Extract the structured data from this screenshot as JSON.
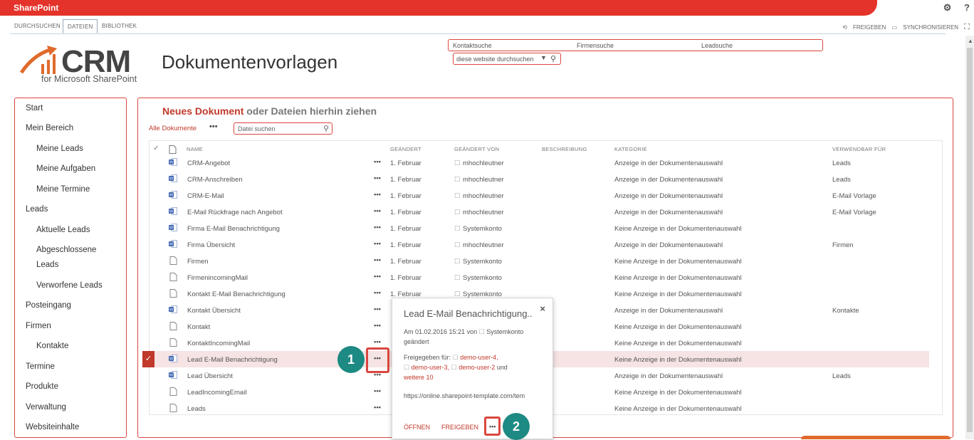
{
  "app": {
    "title": "SharePoint"
  },
  "topicons": {
    "settings": "⚙",
    "help": "?"
  },
  "ribbon": {
    "tabs": [
      "DURCHSUCHEN",
      "DATEIEN",
      "BIBLIOTHEK"
    ]
  },
  "actions": {
    "share": "FREIGEBEN",
    "sync": "SYNCHRONISIEREN"
  },
  "logo": {
    "name": "CRM",
    "sub": "for Microsoft SharePoint"
  },
  "page": {
    "title": "Dokumentenvorlagen"
  },
  "search": {
    "contact": "Kontaktsuche",
    "company": "Firmensuche",
    "lead": "Leadsuche",
    "site_placeholder": "diese website durchsuchen"
  },
  "nav": [
    {
      "label": "Start",
      "level": 0
    },
    {
      "label": "Mein Bereich",
      "level": 0
    },
    {
      "label": "Meine Leads",
      "level": 1
    },
    {
      "label": "Meine Aufgaben",
      "level": 1
    },
    {
      "label": "Meine Termine",
      "level": 1
    },
    {
      "label": "Leads",
      "level": 0
    },
    {
      "label": "Aktuelle Leads",
      "level": 1
    },
    {
      "label": "Abgeschlossene Leads",
      "level": 1
    },
    {
      "label": "Verworfene Leads",
      "level": 1
    },
    {
      "label": "Posteingang",
      "level": 0
    },
    {
      "label": "Firmen",
      "level": 0
    },
    {
      "label": "Kontakte",
      "level": 1
    },
    {
      "label": "Termine",
      "level": 0
    },
    {
      "label": "Produkte",
      "level": 0
    },
    {
      "label": "Verwaltung",
      "level": 0
    },
    {
      "label": "Websiteinhalte",
      "level": 0
    }
  ],
  "library": {
    "new_doc": "Neues Dokument",
    "drag_text": "oder Dateien hierhin ziehen",
    "view": "Alle Dokumente",
    "more": "•••",
    "file_search_placeholder": "Datei suchen",
    "columns": {
      "check": "✓",
      "name": "NAME",
      "modified": "GEÄNDERT",
      "modified_by": "GEÄNDERT VON",
      "description": "BESCHREIBUNG",
      "category": "KATEGORIE",
      "usable_for": "VERWENDBAR FÜR"
    },
    "rows": [
      {
        "icon": "word",
        "name": "CRM-Angebot",
        "modified": "1. Februar",
        "by": "mhochleutner",
        "category": "Anzeige in der Dokumentenauswahl",
        "usable": "Leads"
      },
      {
        "icon": "word",
        "name": "CRM-Anschreiben",
        "modified": "1. Februar",
        "by": "mhochleutner",
        "category": "Anzeige in der Dokumentenauswahl",
        "usable": "Leads"
      },
      {
        "icon": "word",
        "name": "CRM-E-Mail",
        "modified": "1. Februar",
        "by": "mhochleutner",
        "category": "Anzeige in der Dokumentenauswahl",
        "usable": "E-Mail Vorlage"
      },
      {
        "icon": "word",
        "name": "E-Mail Rückfrage nach Angebot",
        "modified": "1. Februar",
        "by": "mhochleutner",
        "category": "Anzeige in der Dokumentenauswahl",
        "usable": "E-Mail Vorlage"
      },
      {
        "icon": "word",
        "name": "Firma E-Mail Benachrichtigung",
        "modified": "1. Februar",
        "by": "Systemkonto",
        "category": "Keine Anzeige in der Dokumentenauswahl",
        "usable": ""
      },
      {
        "icon": "word",
        "name": "Firma Übersicht",
        "modified": "1. Februar",
        "by": "mhochleutner",
        "category": "Anzeige in der Dokumentenauswahl",
        "usable": "Firmen"
      },
      {
        "icon": "file",
        "name": "Firmen",
        "modified": "1. Februar",
        "by": "Systemkonto",
        "category": "Keine Anzeige in der Dokumentenauswahl",
        "usable": ""
      },
      {
        "icon": "file",
        "name": "FirmenincomingMail",
        "modified": "1. Februar",
        "by": "Systemkonto",
        "category": "Keine Anzeige in der Dokumentenauswahl",
        "usable": ""
      },
      {
        "icon": "file",
        "name": "Kontakt E-Mail Benachrichtigung",
        "modified": "1. Februar",
        "by": "Systemkonto",
        "category": "Keine Anzeige in der Dokumentenauswahl",
        "usable": ""
      },
      {
        "icon": "word",
        "name": "Kontakt Übersicht",
        "modified": "",
        "by": "",
        "category": "Anzeige in der Dokumentenauswahl",
        "usable": "Kontakte"
      },
      {
        "icon": "file",
        "name": "Kontakt",
        "modified": "",
        "by": "",
        "category": "Keine Anzeige in der Dokumentenauswahl",
        "usable": ""
      },
      {
        "icon": "file",
        "name": "KontaktIncomingMail",
        "modified": "",
        "by": "",
        "category": "Keine Anzeige in der Dokumentenauswahl",
        "usable": ""
      },
      {
        "icon": "word",
        "name": "Lead E-Mail Benachrichtigung",
        "modified": "",
        "by": "",
        "category": "Keine Anzeige in der Dokumentenauswahl",
        "usable": "",
        "selected": true
      },
      {
        "icon": "word",
        "name": "Lead Übersicht",
        "modified": "",
        "by": "",
        "category": "Anzeige in der Dokumentenauswahl",
        "usable": "Leads"
      },
      {
        "icon": "file",
        "name": "LeadIncomingEmail",
        "modified": "",
        "by": "",
        "category": "Keine Anzeige in der Dokumentenauswahl",
        "usable": ""
      },
      {
        "icon": "file",
        "name": "Leads",
        "modified": "",
        "by": "",
        "category": "Keine Anzeige in der Dokumentenauswahl",
        "usable": ""
      }
    ]
  },
  "popup": {
    "title": "Lead E-Mail Benachrichtigung..",
    "close": "×",
    "modified_prefix": "Am 01.02.2016 15:21 von",
    "modified_user": "Systemkonto",
    "modified_suffix": "geändert",
    "shared_prefix": "Freigegeben für:",
    "user1": "demo-user-4,",
    "user2": "demo-user-3,",
    "user3": "demo-user-2",
    "and": "und",
    "more": "weitere 10",
    "url": "https://online.sharepoint-template.com/tem",
    "open": "ÖFFNEN",
    "share": "FREIGEBEN",
    "menu": "•••"
  },
  "badges": {
    "one": "1",
    "two": "2"
  },
  "colors": {
    "brand": "#e4332a",
    "accent": "#c0392b",
    "badge": "#1d8a83"
  }
}
